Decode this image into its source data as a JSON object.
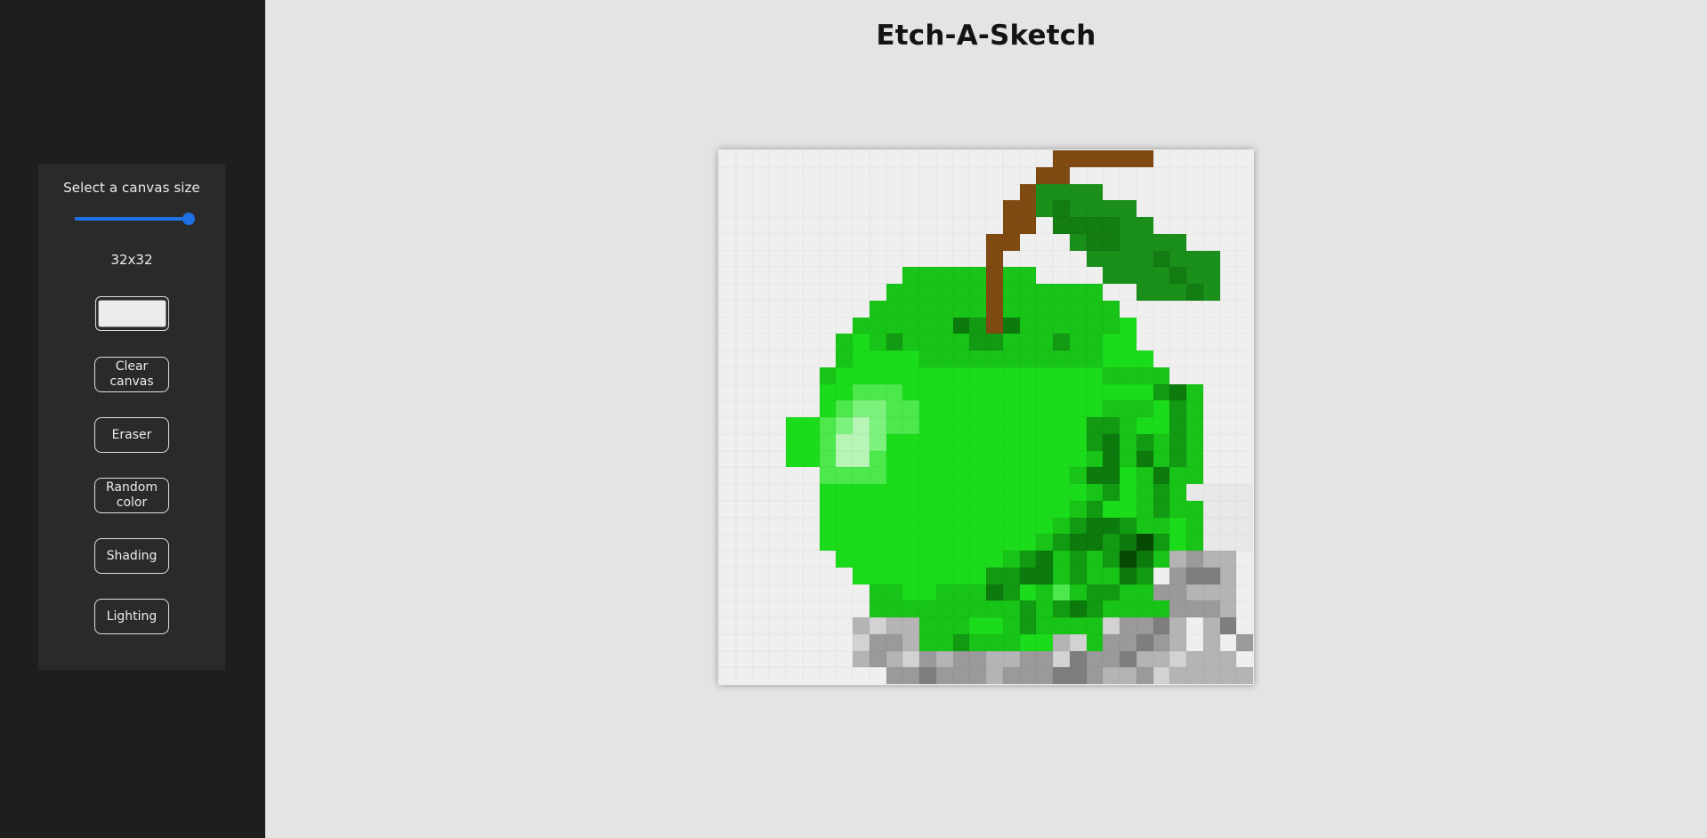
{
  "app": {
    "title": "Etch-A-Sketch"
  },
  "controls": {
    "size_label": "Select a canvas size",
    "size_slider": {
      "min": 1,
      "max": 32,
      "value": 32
    },
    "size_readout": "32x32",
    "current_color": "#ececec",
    "buttons": {
      "clear": "Clear canvas",
      "eraser": "Eraser",
      "random": "Random color",
      "shading": "Shading",
      "lighting": "Lighting"
    }
  },
  "colors": {
    "accent": "#1f6fe5",
    "sidebar_bg": "#1e1e1e",
    "panel_bg": "#2a2a2a",
    "page_bg": "#e4e4e4"
  },
  "canvas": {
    "size": 32,
    "palette": {
      ".": "#efefef",
      "w": "#e8e8e8",
      "G": "#1bdc1b",
      "g": "#18c418",
      "d": "#129a12",
      "D": "#0c7a0c",
      "K": "#064a06",
      "L": "#4ce84c",
      "H": "#7cf27c",
      "W": "#b6f5b6",
      "b": "#7f4b12",
      "f": "#1a8f1a",
      "F": "#137c13",
      "1": "#d2d2d2",
      "2": "#b4b4b4",
      "3": "#9a9a9a",
      "4": "#7e7e7e"
    },
    "rows": [
      "....................bbbbbb......",
      "...................bb...........",
      "..................bffff.........",
      ".................bbfFffff.......",
      ".................bb.FFFFff......",
      "................bb...fFFffff....",
      "................b.....ffffFfff..",
      "...........gggggbgg....ffffFff..",
      "..........ggggggbgggggg..fffFf..",
      ".........gggggggbggggggg........",
      "........ggggggDdbDggggggG.......",
      ".......gGgdggggddgggdggGG.......",
      ".......gGGGGgggggggggggGGG......",
      "......gGGGGGGGGGGGGGGGGgggg.....",
      "......GGLLLGGGGGGGGGGGGGGGdDg...",
      "......GLHHLLGGGGGGGGGGGgggGdg...",
      "....GGLHWHLLGGGGGGGGGGddgGGdg...",
      "....GGLWWHGGGGGGGGGGGGdDgdgdg...",
      "....GGLWWLGGGGGGGGGGGGgDgDgdg...",
      "......LLLLGGGGGGGGGGGgDDGgDgg...",
      "......GGGGGGGGGGGGGGGGgdGgdgwwwww",
      "......GGGGGGGGGGGGGGGgdGGgdggwwww",
      "......GGGGGGGGGGGGGGgdDDdggGgwwww",
      "......GGGGGGGGGGGGGgdDDdDKdGgwwww",
      ".......GGGGGGGGGGgdDgdgdKDg2322.2",
      "........GGGGGGGGddDDgdggDd.3442.4",
      ".........ggGGgggDdGgLgddgg33222.2",
      ".........gggggggggdgdDdgggg3332..",
      "........2122gggGGgdgggg13342.24.",
      "........1332ggdgggGG21g33432.2.3",
      "........23213233223314334221222.",
      "..........3343332333443223122222"
    ]
  }
}
